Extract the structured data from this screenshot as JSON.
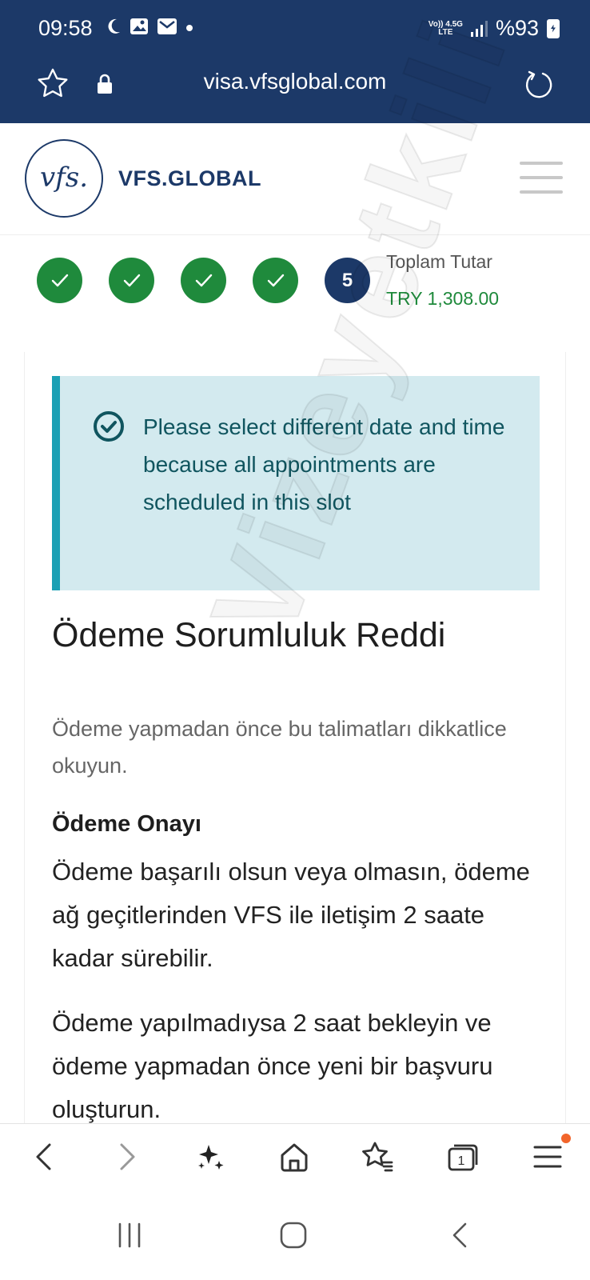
{
  "status_bar": {
    "time": "09:58",
    "network_top": "Vo)) 4.5G",
    "network_bottom": "LTE",
    "battery": "%93"
  },
  "browser": {
    "url": "visa.vfsglobal.com"
  },
  "header": {
    "logo_mark": "vfs.",
    "brand": "VFS.GLOBAL"
  },
  "progress": {
    "completed_steps": 4,
    "current_step": "5",
    "total_label": "Toplam Tutar",
    "total_value": "TRY 1,308.00"
  },
  "alert": {
    "text": "Please select different date and time because all appointments are scheduled in this slot"
  },
  "content": {
    "title": "Ödeme Sorumluluk Reddi",
    "intro": "Ödeme yapmadan önce bu talimatları dikkatlice okuyun.",
    "section_title": "Ödeme Onayı",
    "paragraph1": "Ödeme başarılı olsun veya olmasın, ödeme ağ geçitlerinden VFS ile iletişim 2 saate kadar sürebilir.",
    "paragraph2": "Ödeme yapılmadıysa 2 saat bekleyin ve ödeme yapmadan önce yeni bir başvuru oluşturun."
  },
  "watermark": "Vizeyetkili",
  "colors": {
    "header_bg": "#1c3968",
    "step_done": "#1f8a3c",
    "alert_bg": "#d3eaef",
    "alert_border": "#1ba0b4",
    "badge": "#f2652b"
  },
  "icons": {
    "toolbar": [
      "back-icon",
      "forward-icon",
      "sparkle-icon",
      "home-icon",
      "bookmarks-icon",
      "tabs-icon",
      "menu-icon"
    ],
    "tabs_count": "1",
    "system": [
      "recents-icon",
      "home-circle-icon",
      "back-system-icon"
    ]
  }
}
